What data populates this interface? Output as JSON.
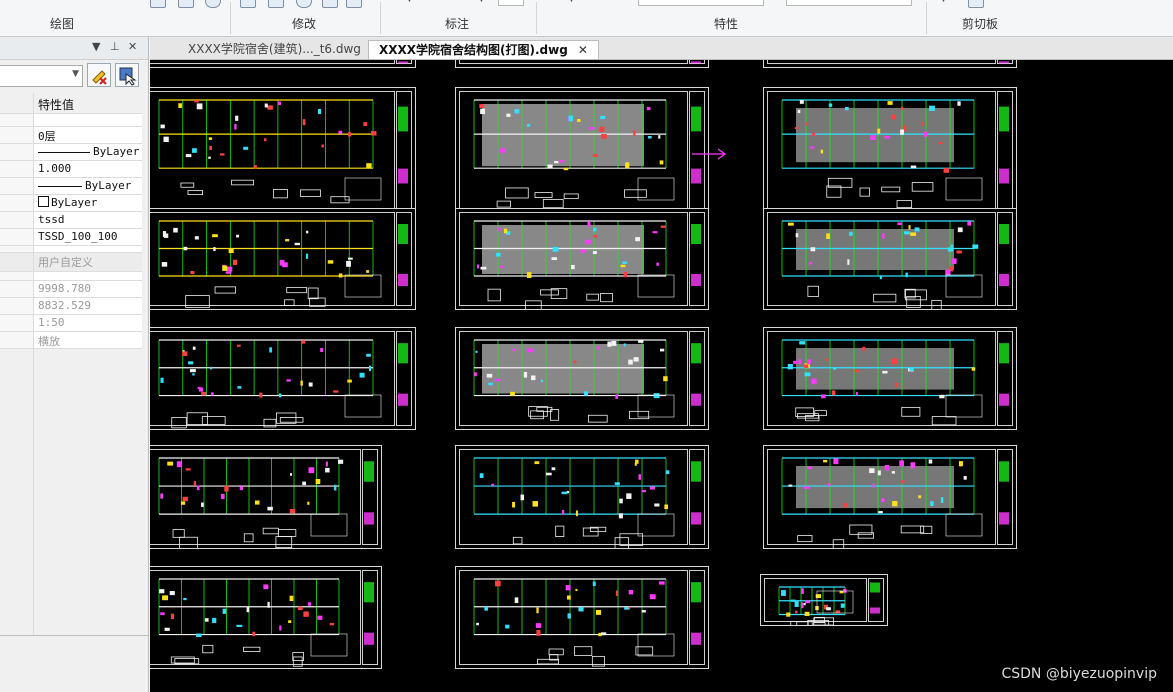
{
  "ribbon": {
    "groups": [
      {
        "label": "绘图"
      },
      {
        "label": "修改"
      },
      {
        "label": "标注"
      },
      {
        "label": "特性"
      },
      {
        "label": "剪切板"
      }
    ]
  },
  "properties_panel": {
    "column_header": "特性值",
    "values": [
      "0层",
      "ByLayer",
      "1.000",
      "ByLayer",
      "ByLayer",
      "tssd",
      "TSSD_100_100"
    ],
    "section_label": "用户自定义",
    "misc_values": [
      "9998.780",
      "8832.529",
      "1:50",
      "横放"
    ]
  },
  "tabs": [
    {
      "label": "XXXX学院宿舍(建筑)..._t6.dwg",
      "active": false
    },
    {
      "label": "XXXX学院宿舍结构图(打图).dwg",
      "active": true
    }
  ],
  "tab_close_glyph": "✕",
  "watermark": "CSDN @biyezuopinvip",
  "colors": {
    "canvas_bg": "#000000",
    "drawing_green": "#19e619",
    "drawing_cyan": "#33e0ff",
    "drawing_magenta": "#ff3bff",
    "drawing_yellow": "#ffe019",
    "drawing_white": "#f2f2f2",
    "drawing_red": "#ff4040"
  }
}
